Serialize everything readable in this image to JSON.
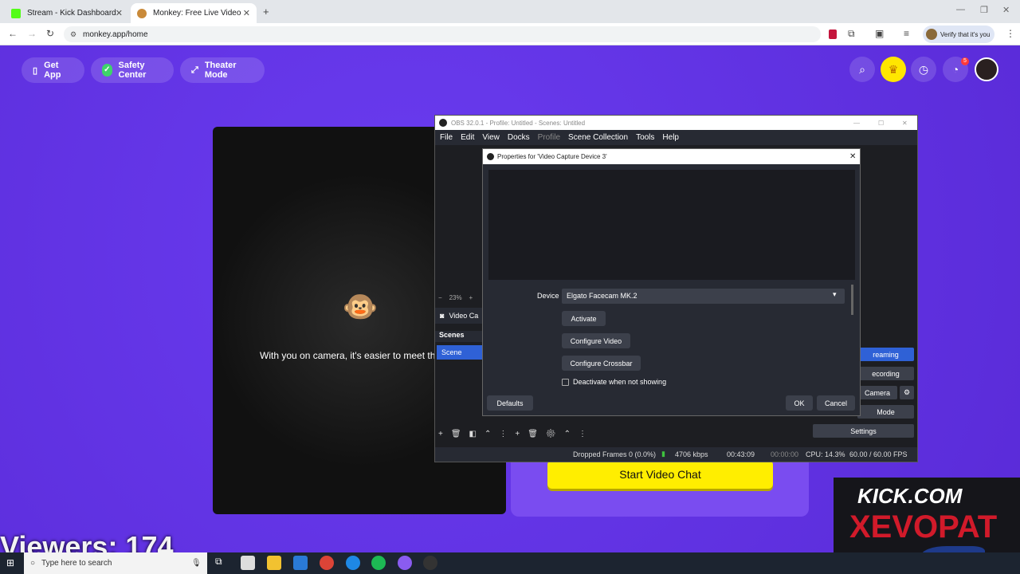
{
  "browser": {
    "tabs": [
      {
        "label": "Stream - Kick Dashboard"
      },
      {
        "label": "Monkey: Free Live Video Chat"
      }
    ],
    "url": "monkey.app/home",
    "profile_label": "Verify that it's you"
  },
  "site": {
    "get_app": "Get App",
    "safety_center": "Safety Center",
    "theater_mode": "Theater Mode",
    "notification_count": "5",
    "camera_prompt": "With you on camera, it's easier to meet the rig",
    "start_button": "Start Video Chat",
    "viewers": "Viewers: 174"
  },
  "obs": {
    "title": "OBS 32.0.1 - Profile: Untitled - Scenes: Untitled",
    "menu": [
      "File",
      "Edit",
      "View",
      "Docks",
      "Profile",
      "Scene Collection",
      "Tools",
      "Help"
    ],
    "zoom": "23%",
    "source_label": "Video Ca",
    "scenes_header": "Scenes",
    "scene_item": "Scene",
    "controls": [
      "reaming",
      "ecording",
      "Camera",
      "Mode",
      "Settings"
    ],
    "status": {
      "dropped": "Dropped Frames 0 (0.0%)",
      "bitrate": "4706 kbps",
      "stream_time": "00:43:09",
      "rec_time": "00:00:00",
      "cpu": "CPU: 14.3%",
      "fps": "60.00 / 60.00 FPS"
    }
  },
  "dialog": {
    "title": "Properties for 'Video Capture Device 3'",
    "device_label": "Device",
    "device_value": "Elgato Facecam MK.2",
    "activate": "Activate",
    "configure_video": "Configure Video",
    "configure_crossbar": "Configure Crossbar",
    "deactivate_label": "Deactivate when not showing",
    "defaults": "Defaults",
    "ok": "OK",
    "cancel": "Cancel"
  },
  "overlay": {
    "line1": "KICK.COM",
    "line2": "XEVOPAT"
  },
  "taskbar": {
    "search_placeholder": "Type here to search"
  },
  "colors": {
    "site_bg": "#6432e0",
    "accent_yellow": "#ffee00",
    "obs_bg": "#1d1e22"
  }
}
